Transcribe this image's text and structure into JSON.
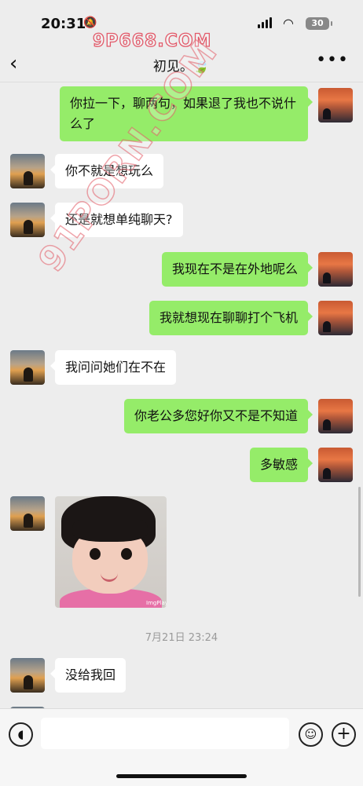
{
  "status_bar": {
    "time": "20:31",
    "battery": "30",
    "icons": [
      "bell-slash-icon",
      "signal-icon",
      "wifi-icon",
      "battery-icon"
    ]
  },
  "watermarks": {
    "top": "9P668.COM",
    "diagonal": "91PORN.COM"
  },
  "header": {
    "back_icon": "chevron-left-icon",
    "title": "初见。🍃",
    "more_icon": "more-dots-icon"
  },
  "messages": [
    {
      "side": "right",
      "type": "text",
      "text": "你拉一下，聊两句，如果退了我也不说什么了"
    },
    {
      "side": "left",
      "type": "text",
      "text": "你不就是想玩么"
    },
    {
      "side": "left",
      "type": "text",
      "text": "还是就想单纯聊天?"
    },
    {
      "side": "right",
      "type": "text",
      "text": "我现在不是在外地呢么"
    },
    {
      "side": "right",
      "type": "text",
      "text": "我就想现在聊聊打个飞机"
    },
    {
      "side": "left",
      "type": "text",
      "text": "我问问她们在不在"
    },
    {
      "side": "right",
      "type": "text",
      "text": "你老公多您好你又不是不知道"
    },
    {
      "side": "right",
      "type": "text",
      "text": "多敏感"
    },
    {
      "side": "left",
      "type": "sticker",
      "brand": "ImgPlay"
    },
    {
      "type": "time",
      "text": "7月21日 23:24"
    },
    {
      "side": "left",
      "type": "text",
      "text": "没给我回"
    }
  ],
  "input_bar": {
    "voice_icon": "voice-icon",
    "placeholder": "",
    "emoji_icon": "emoji-icon",
    "plus_icon": "plus-icon"
  },
  "colors": {
    "background": "#ededed",
    "bubble_self": "#95ec69",
    "bubble_other": "#ffffff",
    "timestamp": "#9a9a9a"
  }
}
